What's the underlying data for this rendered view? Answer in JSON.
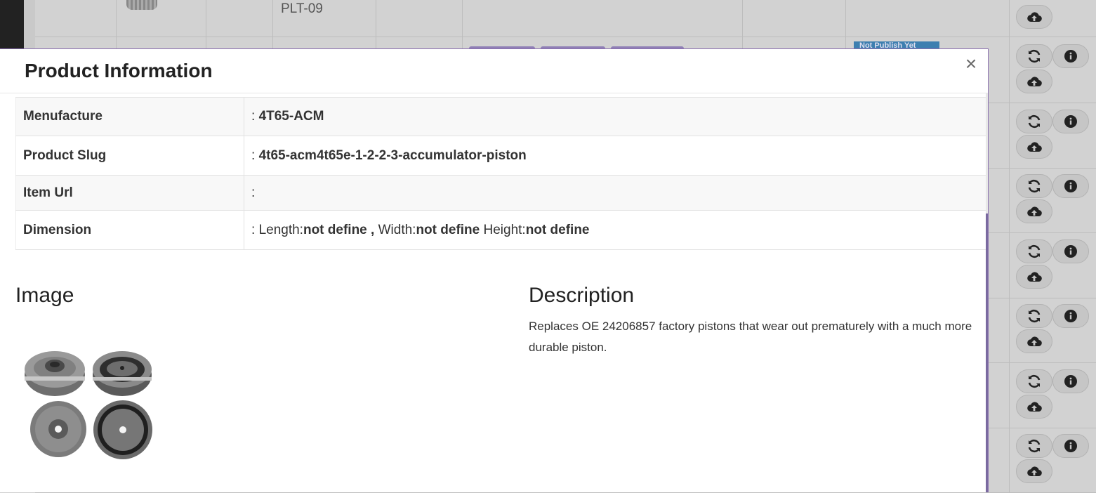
{
  "background": {
    "sku_text": "PLT-09",
    "badge_text": "Not Publish Yet",
    "row_actions": [
      "refresh-icon",
      "info-icon",
      "cloud-upload-icon"
    ]
  },
  "modal": {
    "title": "Product Information",
    "close_label": "×",
    "rows": [
      {
        "label": "Menufacture",
        "prefix": ": ",
        "value": "4T65-ACM"
      },
      {
        "label": "Product Slug",
        "prefix": ": ",
        "value": "4t65-acm4t65e-1-2-2-3-accumulator-piston"
      },
      {
        "label": "Item Url",
        "prefix": ":",
        "value": ""
      },
      {
        "label": "Dimension",
        "prefix": ": ",
        "length_label": "Length:",
        "length_value": "not define",
        "width_sep": " , ",
        "width_label": "Width:",
        "width_value": "not define",
        "height_label": " Height:",
        "height_value": "not define"
      }
    ],
    "image_heading": "Image",
    "description_heading": "Description",
    "description_text": "Replaces OE 24206857 factory pistons that wear out prematurely with a much more durable piston."
  }
}
